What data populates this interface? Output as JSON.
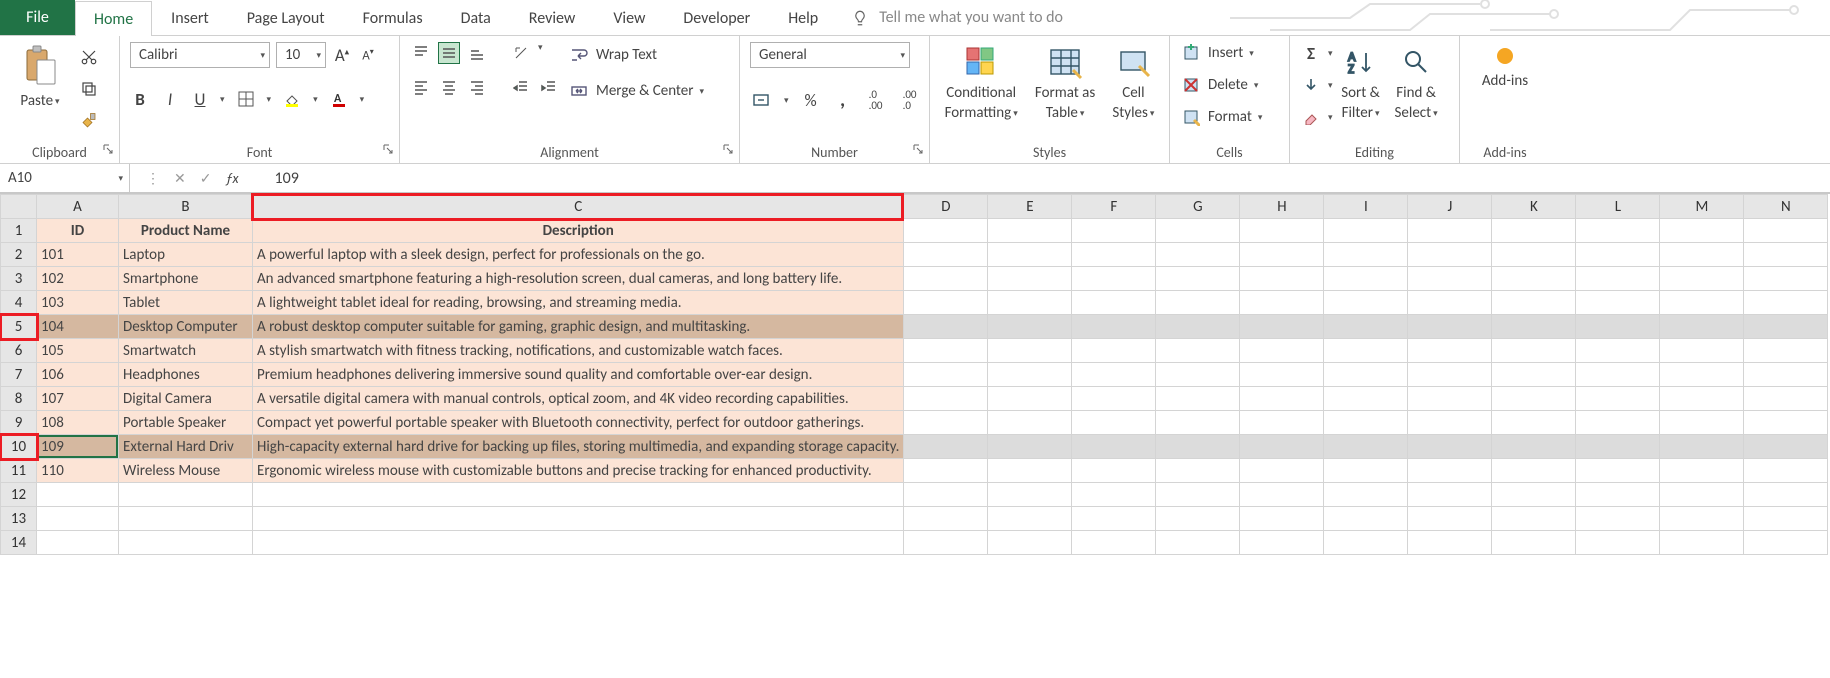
{
  "tabs": {
    "file": "File",
    "items": [
      "Home",
      "Insert",
      "Page Layout",
      "Formulas",
      "Data",
      "Review",
      "View",
      "Developer",
      "Help"
    ],
    "tell_placeholder": "Tell me what you want to do"
  },
  "ribbon": {
    "clipboard": {
      "label": "Clipboard",
      "paste": "Paste"
    },
    "font": {
      "label": "Font",
      "name": "Calibri",
      "size": "10",
      "bold": "B",
      "italic": "I",
      "underline": "U"
    },
    "alignment": {
      "label": "Alignment",
      "wrap": "Wrap Text",
      "merge": "Merge & Center"
    },
    "number": {
      "label": "Number",
      "format": "General",
      "pct": "%",
      "comma": ","
    },
    "styles": {
      "label": "Styles",
      "cond": "Conditional",
      "cond2": "Formatting",
      "fat": "Format as",
      "fat2": "Table",
      "cell": "Cell",
      "cell2": "Styles"
    },
    "cells": {
      "label": "Cells",
      "insert": "Insert",
      "delete": "Delete",
      "format": "Format"
    },
    "editing": {
      "label": "Editing",
      "sort": "Sort &",
      "sort2": "Filter",
      "find": "Find &",
      "find2": "Select"
    },
    "addins": {
      "label": "Add-ins",
      "btn": "Add-ins"
    }
  },
  "namebox": "A10",
  "formula": "109",
  "columns": [
    "A",
    "B",
    "C",
    "D",
    "E",
    "F",
    "G",
    "H",
    "I",
    "J",
    "K",
    "L",
    "M",
    "N"
  ],
  "header_row": {
    "id": "ID",
    "name": "Product Name",
    "desc": "Description"
  },
  "rows": [
    {
      "r": "1",
      "id": "",
      "name": "",
      "desc": ""
    },
    {
      "r": "2",
      "id": "101",
      "name": "Laptop",
      "desc": "A powerful laptop with a sleek design, perfect for professionals on the go."
    },
    {
      "r": "3",
      "id": "102",
      "name": "Smartphone",
      "desc": "An advanced smartphone featuring a high-resolution screen, dual cameras, and long battery life."
    },
    {
      "r": "4",
      "id": "103",
      "name": "Tablet",
      "desc": "A lightweight tablet ideal for reading, browsing, and streaming media."
    },
    {
      "r": "5",
      "id": "104",
      "name": "Desktop Computer",
      "desc": "A robust desktop computer suitable for gaming, graphic design, and multitasking."
    },
    {
      "r": "6",
      "id": "105",
      "name": "Smartwatch",
      "desc": "A stylish smartwatch with fitness tracking, notifications, and customizable watch faces."
    },
    {
      "r": "7",
      "id": "106",
      "name": "Headphones",
      "desc": "Premium headphones delivering immersive sound quality and comfortable over-ear design."
    },
    {
      "r": "8",
      "id": "107",
      "name": "Digital Camera",
      "desc": "A versatile digital camera with manual controls, optical zoom, and 4K video recording capabilities."
    },
    {
      "r": "9",
      "id": "108",
      "name": "Portable Speaker",
      "desc": "Compact yet powerful portable speaker with Bluetooth connectivity, perfect for outdoor gatherings."
    },
    {
      "r": "10",
      "id": "109",
      "name": "External Hard Driv",
      "desc": "High-capacity external hard drive for backing up files, storing multimedia, and expanding storage capacity."
    },
    {
      "r": "11",
      "id": "110",
      "name": "Wireless Mouse",
      "desc": "Ergonomic wireless mouse with customizable buttons and precise tracking for enhanced productivity."
    },
    {
      "r": "12",
      "id": "",
      "name": "",
      "desc": ""
    },
    {
      "r": "13",
      "id": "",
      "name": "",
      "desc": ""
    },
    {
      "r": "14",
      "id": "",
      "name": "",
      "desc": ""
    }
  ]
}
